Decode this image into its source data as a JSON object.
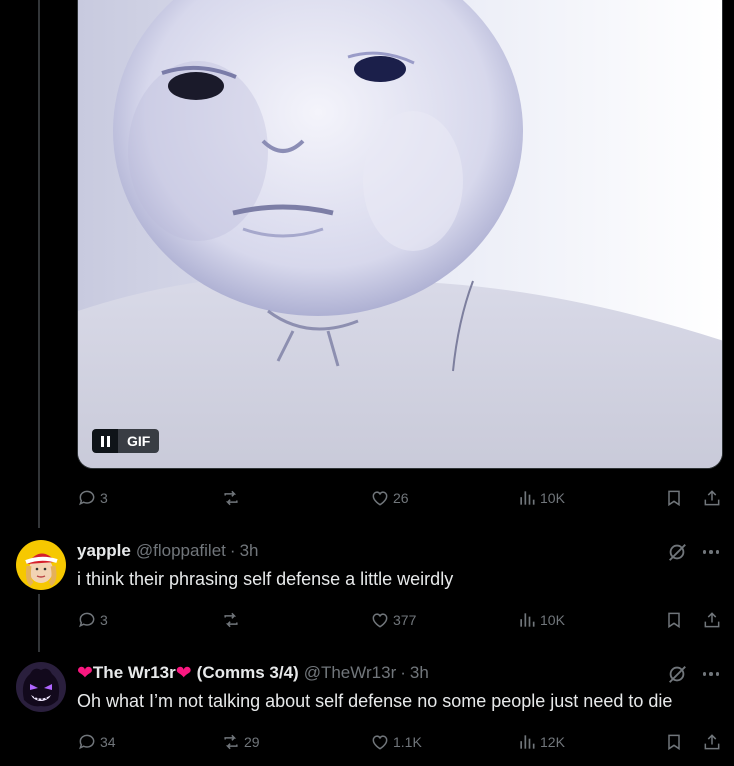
{
  "gif": {
    "label": "GIF"
  },
  "media_post": {
    "stats": {
      "replies": "3",
      "reposts": "",
      "likes": "26",
      "views": "10K"
    }
  },
  "tweets": [
    {
      "name": "yapple",
      "handle": "@floppafilet",
      "time": "3h",
      "text": "i think their phrasing self defense a little weirdly",
      "stats": {
        "replies": "3",
        "reposts": "",
        "likes": "377",
        "views": "10K"
      }
    },
    {
      "name": "The Wr13r",
      "name_suffix": "(Comms 3/4)",
      "handle": "@TheWr13r",
      "time": "3h",
      "text": "Oh what I’m not talking about self defense no some people just need to die",
      "stats": {
        "replies": "34",
        "reposts": "29",
        "likes": "1.1K",
        "views": "12K"
      }
    }
  ],
  "separator": "·",
  "heart_glyph": "❤",
  "colors": {
    "background": "#000000",
    "text": "#e7e9ea",
    "muted": "#71767b",
    "heart": "#f91880"
  },
  "icons": [
    "pause-icon",
    "reply-icon",
    "repost-icon",
    "like-icon",
    "views-icon",
    "bookmark-icon",
    "share-icon",
    "grok-icon",
    "more-icon"
  ]
}
